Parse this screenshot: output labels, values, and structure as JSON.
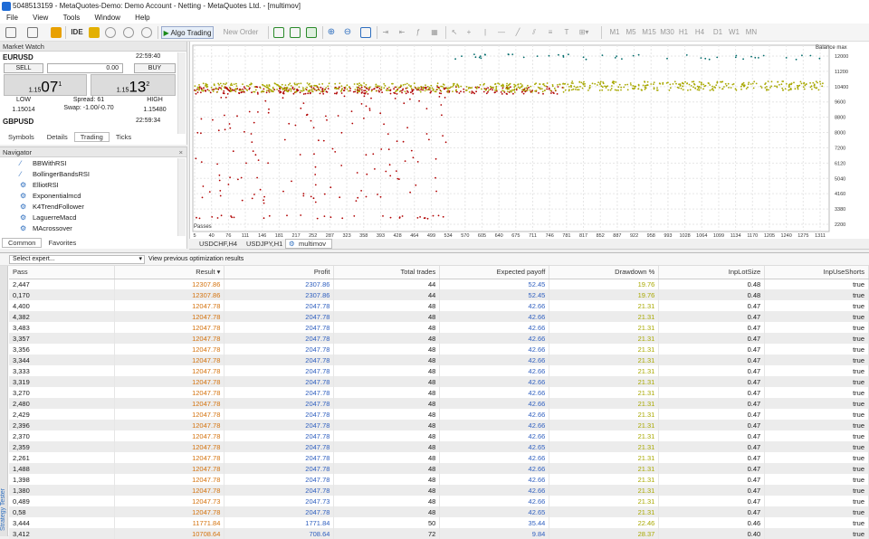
{
  "window": {
    "title": "5048513159 - MetaQuotes-Demo: Demo Account - Netting - MetaQuotes Ltd. - [multimov]"
  },
  "menu": [
    "File",
    "View",
    "Tools",
    "Window",
    "Help"
  ],
  "toolbar": {
    "ide_label": "IDE",
    "algo_trading_label": "Algo Trading",
    "new_order_label": "New Order",
    "timeframes": [
      "M1",
      "M5",
      "M15",
      "M30",
      "H1",
      "H4",
      "D1",
      "W1",
      "MN"
    ]
  },
  "market_watch": {
    "title": "Market Watch",
    "eurusd": {
      "symbol": "EURUSD",
      "time": "22:59:40",
      "sell_label": "SELL",
      "buy_label": "BUY",
      "volume": "0.00",
      "bid_small": "1.15",
      "bid_big": "07",
      "bid_sup": "1",
      "ask_small": "1.15",
      "ask_big": "13",
      "ask_sup": "2",
      "low_label": "LOW",
      "high_label": "HIGH",
      "spread": "Spread: 61",
      "swap": "Swap: -1.00/-0.70",
      "low": "1.15014",
      "high": "1.15480"
    },
    "gbpusd": {
      "symbol": "GBPUSD",
      "time": "22:59:34"
    },
    "tabs": [
      "Symbols",
      "Details",
      "Trading",
      "Ticks"
    ],
    "active_tab": "Trading"
  },
  "navigator": {
    "title": "Navigator",
    "items": [
      "BBWithRSI",
      "BollingerBandsRSI",
      "ElliotRSI",
      "Exponentialmcd",
      "K4TrendFollower",
      "LaguerreMacd",
      "MAcrossover"
    ],
    "tabs": [
      "Common",
      "Favorites"
    ],
    "active_tab": "Common"
  },
  "chart": {
    "balance_label": "Balance max",
    "passes_label": "Passes",
    "y_ticks": [
      "12000",
      "11200",
      "10400",
      "9600",
      "8800",
      "8000",
      "7200",
      "6120",
      "5040",
      "4160",
      "3380",
      "2200"
    ],
    "x_ticks": [
      "5",
      "40",
      "76",
      "111",
      "146",
      "181",
      "217",
      "252",
      "287",
      "323",
      "358",
      "393",
      "428",
      "464",
      "499",
      "534",
      "570",
      "605",
      "640",
      "675",
      "711",
      "746",
      "781",
      "817",
      "852",
      "887",
      "922",
      "958",
      "993",
      "1028",
      "1064",
      "1099",
      "1134",
      "1170",
      "1205",
      "1240",
      "1275",
      "1311"
    ],
    "tabs": [
      "USDCHF,H4",
      "USDJPY,H1",
      "multimov"
    ],
    "active_tab": "multimov",
    "colors": {
      "red": "#b00000",
      "olive": "#a8a800",
      "teal": "#006b6b"
    }
  },
  "tester": {
    "select_expert": "Select expert...",
    "view_previous": "View previous optimization results",
    "strip_label": "Strategy Tester",
    "columns": [
      "Pass",
      "Result",
      "Profit",
      "Total trades",
      "Expected payoff",
      "Drawdown %",
      "InpLotSize",
      "InpUseShorts"
    ],
    "rows": [
      [
        "2,447",
        "12307.86",
        "2307.86",
        "44",
        "52.45",
        "19.76",
        "0.48",
        "true"
      ],
      [
        "0,170",
        "12307.86",
        "2307.86",
        "44",
        "52.45",
        "19.76",
        "0.48",
        "true"
      ],
      [
        "4,400",
        "12047.78",
        "2047.78",
        "48",
        "42.66",
        "21.31",
        "0.47",
        "true"
      ],
      [
        "4,382",
        "12047.78",
        "2047.78",
        "48",
        "42.66",
        "21.31",
        "0.47",
        "true"
      ],
      [
        "3,483",
        "12047.78",
        "2047.78",
        "48",
        "42.66",
        "21.31",
        "0.47",
        "true"
      ],
      [
        "3,357",
        "12047.78",
        "2047.78",
        "48",
        "42.66",
        "21.31",
        "0.47",
        "true"
      ],
      [
        "3,356",
        "12047.78",
        "2047.78",
        "48",
        "42.66",
        "21.31",
        "0.47",
        "true"
      ],
      [
        "3,344",
        "12047.78",
        "2047.78",
        "48",
        "42.66",
        "21.31",
        "0.47",
        "true"
      ],
      [
        "3,333",
        "12047.78",
        "2047.78",
        "48",
        "42.66",
        "21.31",
        "0.47",
        "true"
      ],
      [
        "3,319",
        "12047.78",
        "2047.78",
        "48",
        "42.66",
        "21.31",
        "0.47",
        "true"
      ],
      [
        "3,270",
        "12047.78",
        "2047.78",
        "48",
        "42.66",
        "21.31",
        "0.47",
        "true"
      ],
      [
        "2,480",
        "12047.78",
        "2047.78",
        "48",
        "42.66",
        "21.31",
        "0.47",
        "true"
      ],
      [
        "2,429",
        "12047.78",
        "2047.78",
        "48",
        "42.66",
        "21.31",
        "0.47",
        "true"
      ],
      [
        "2,396",
        "12047.78",
        "2047.78",
        "48",
        "42.66",
        "21.31",
        "0.47",
        "true"
      ],
      [
        "2,370",
        "12047.78",
        "2047.78",
        "48",
        "42.66",
        "21.31",
        "0.47",
        "true"
      ],
      [
        "2,359",
        "12047.78",
        "2047.78",
        "48",
        "42.65",
        "21.31",
        "0.47",
        "true"
      ],
      [
        "2,261",
        "12047.78",
        "2047.78",
        "48",
        "42.66",
        "21.31",
        "0.47",
        "true"
      ],
      [
        "1,488",
        "12047.78",
        "2047.78",
        "48",
        "42.66",
        "21.31",
        "0.47",
        "true"
      ],
      [
        "1,398",
        "12047.78",
        "2047.78",
        "48",
        "42.66",
        "21.31",
        "0.47",
        "true"
      ],
      [
        "1,380",
        "12047.78",
        "2047.78",
        "48",
        "42.66",
        "21.31",
        "0.47",
        "true"
      ],
      [
        "0,489",
        "12047.73",
        "2047.73",
        "48",
        "42.66",
        "21.31",
        "0.47",
        "true"
      ],
      [
        "0,58",
        "12047.78",
        "2047.78",
        "48",
        "42.65",
        "21.31",
        "0.47",
        "true"
      ],
      [
        "3,444",
        "11771.84",
        "1771.84",
        "50",
        "35.44",
        "22.46",
        "0.46",
        "true"
      ],
      [
        "3,412",
        "10708.64",
        "708.64",
        "72",
        "9.84",
        "28.37",
        "0.40",
        "true"
      ]
    ]
  }
}
